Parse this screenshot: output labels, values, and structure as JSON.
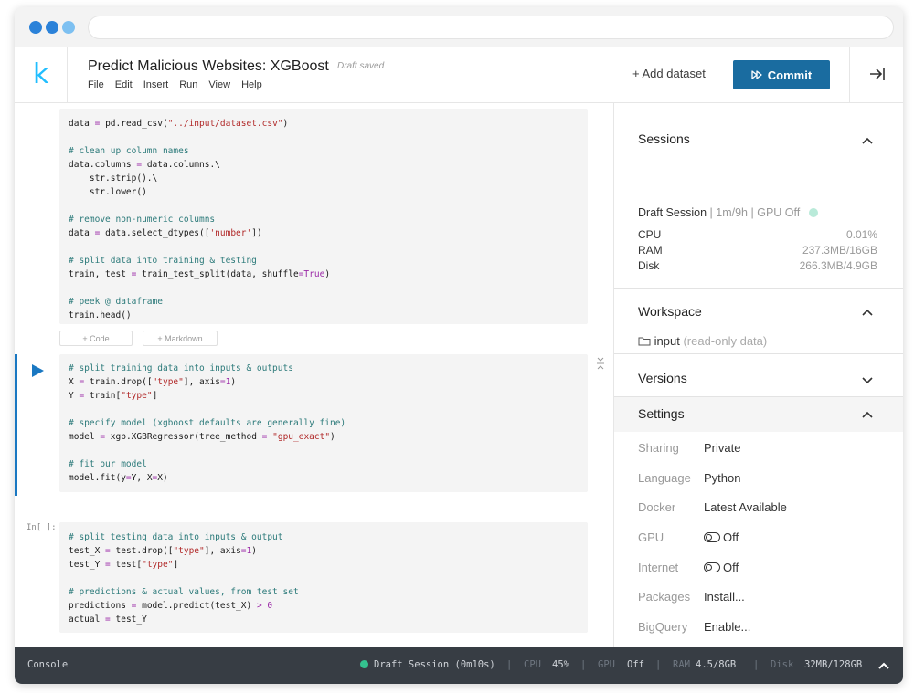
{
  "header": {
    "logo": "k",
    "title": "Predict Malicious Websites: XGBoost",
    "draft_status": "Draft saved",
    "menu": [
      "File",
      "Edit",
      "Insert",
      "Run",
      "View",
      "Help"
    ],
    "add_dataset": "+ Add dataset",
    "commit": "Commit"
  },
  "cells": {
    "cell1": [
      "data = pd.read_csv(\"../input/dataset.csv\")",
      "",
      "# clean up column names",
      "data.columns = data.columns.\\",
      "    str.strip().\\",
      "    str.lower()",
      "",
      "# remove non-numeric columns",
      "data = data.select_dtypes(['number'])",
      "",
      "# split data into training & testing",
      "train, test = train_test_split(data, shuffle=True)",
      "",
      "# peek @ dataframe",
      "train.head()"
    ],
    "add_code": "+ Code",
    "add_markdown": "+ Markdown",
    "cell2": [
      "# split training data into inputs & outputs",
      "X = train.drop([\"type\"], axis=1)",
      "Y = train[\"type\"]",
      "",
      "# specify model (xgboost defaults are generally fine)",
      "model = xgb.XGBRegressor(tree_method = \"gpu_exact\")",
      "",
      "# fit our model",
      "model.fit(y=Y, X=X)"
    ],
    "cell3_label": "In[ ]:",
    "cell3": [
      "# split testing data into inputs & output",
      "test_X = test.drop([\"type\"], axis=1)",
      "test_Y = test[\"type\"]",
      "",
      "# predictions & actual values, from test set",
      "predictions = model.predict(test_X) > 0",
      "actual = test_Y"
    ]
  },
  "sidebar": {
    "sessions": {
      "title": "Sessions",
      "session_name": "Draft Session",
      "runtime": "1m/9h",
      "gpu": "GPU Off",
      "stats": [
        {
          "label": "CPU",
          "value": "0.01%"
        },
        {
          "label": "RAM",
          "value": "237.3MB/16GB"
        },
        {
          "label": "Disk",
          "value": "266.3MB/4.9GB"
        }
      ]
    },
    "workspace": {
      "title": "Workspace",
      "folder": "input",
      "note": "(read-only data)"
    },
    "versions": {
      "title": "Versions"
    },
    "settings": {
      "title": "Settings",
      "rows": [
        {
          "label": "Sharing",
          "value": "Private"
        },
        {
          "label": "Language",
          "value": "Python"
        },
        {
          "label": "Docker",
          "value": "Latest Available"
        },
        {
          "label": "GPU",
          "value": "Off"
        },
        {
          "label": "Internet",
          "value": "Off"
        },
        {
          "label": "Packages",
          "value": "Install..."
        },
        {
          "label": "BigQuery",
          "value": "Enable..."
        }
      ]
    }
  },
  "statusbar": {
    "console": "Console",
    "session": "Draft Session (0m10s)",
    "cpu_label": "CPU",
    "cpu_value": "45%",
    "gpu_label": "GPU",
    "gpu_value": "Off",
    "ram_label": "RAM",
    "ram_value": "4.5/8GB",
    "disk_label": "Disk",
    "disk_value": "32MB/128GB"
  },
  "colors": {
    "accent": "#1a6ca0",
    "logo": "#20beff",
    "status_bar": "#373d44",
    "session_active": "#34c28f"
  }
}
